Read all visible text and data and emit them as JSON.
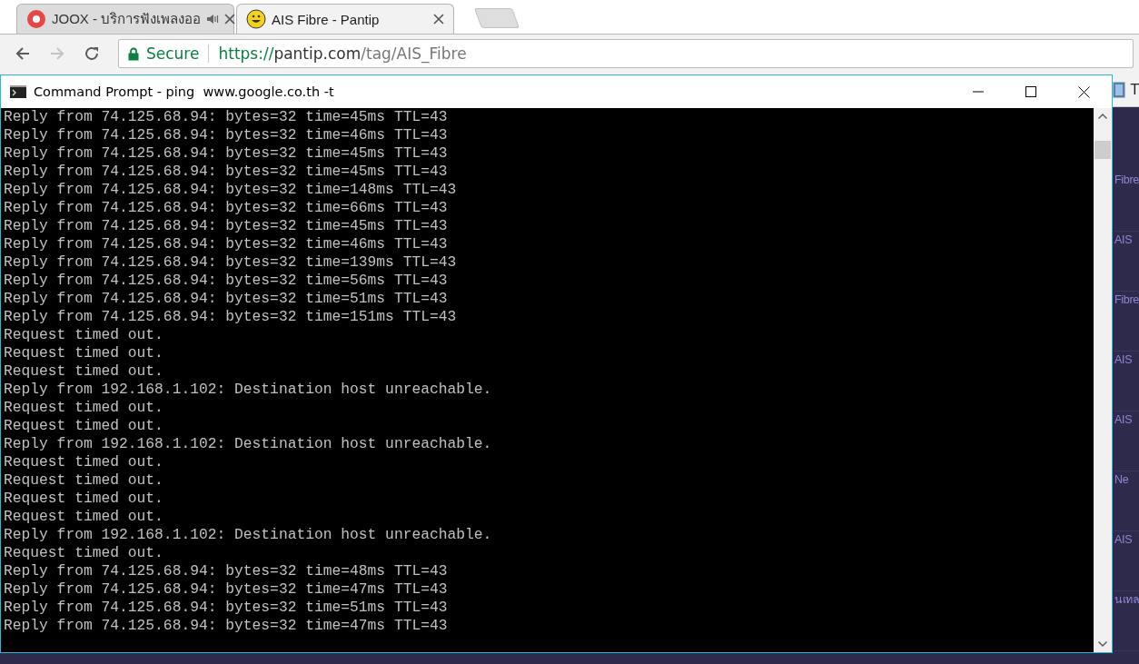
{
  "browser": {
    "tabs": [
      {
        "title": "JOOX - บริการฟังเพลงออ",
        "selected": false,
        "audio": true
      },
      {
        "title": "AIS Fibre - Pantip",
        "selected": true,
        "audio": false
      }
    ],
    "nav": [
      {
        "kind": "back",
        "disabled": false
      },
      {
        "kind": "forward",
        "disabled": true
      },
      {
        "kind": "reload",
        "disabled": false
      }
    ],
    "security": "Secure",
    "url": "https://pantip.com/tag/AIS_Fibre",
    "bookmark": "T"
  },
  "page": {
    "items": [
      "Fibre",
      "AIS",
      "Fibre",
      "AIS",
      "AIS",
      "Ne",
      "AIS",
      "นเทล"
    ]
  },
  "console_window": {
    "title": "Command Prompt - ping  www.google.co.th -t",
    "lines": [
      "Reply from 74.125.68.94: bytes=32 time=45ms TTL=43",
      "Reply from 74.125.68.94: bytes=32 time=46ms TTL=43",
      "Reply from 74.125.68.94: bytes=32 time=45ms TTL=43",
      "Reply from 74.125.68.94: bytes=32 time=45ms TTL=43",
      "Reply from 74.125.68.94: bytes=32 time=148ms TTL=43",
      "Reply from 74.125.68.94: bytes=32 time=66ms TTL=43",
      "Reply from 74.125.68.94: bytes=32 time=45ms TTL=43",
      "Reply from 74.125.68.94: bytes=32 time=46ms TTL=43",
      "Reply from 74.125.68.94: bytes=32 time=139ms TTL=43",
      "Reply from 74.125.68.94: bytes=32 time=56ms TTL=43",
      "Reply from 74.125.68.94: bytes=32 time=51ms TTL=43",
      "Reply from 74.125.68.94: bytes=32 time=151ms TTL=43",
      "Request timed out.",
      "Request timed out.",
      "Request timed out.",
      "Reply from 192.168.1.102: Destination host unreachable.",
      "Request timed out.",
      "Request timed out.",
      "Reply from 192.168.1.102: Destination host unreachable.",
      "Request timed out.",
      "Request timed out.",
      "Request timed out.",
      "Request timed out.",
      "Reply from 192.168.1.102: Destination host unreachable.",
      "Request timed out.",
      "Reply from 74.125.68.94: bytes=32 time=48ms TTL=43",
      "Reply from 74.125.68.94: bytes=32 time=47ms TTL=43",
      "Reply from 74.125.68.94: bytes=32 time=51ms TTL=43",
      "Reply from 74.125.68.94: bytes=32 time=47ms TTL=43"
    ]
  }
}
